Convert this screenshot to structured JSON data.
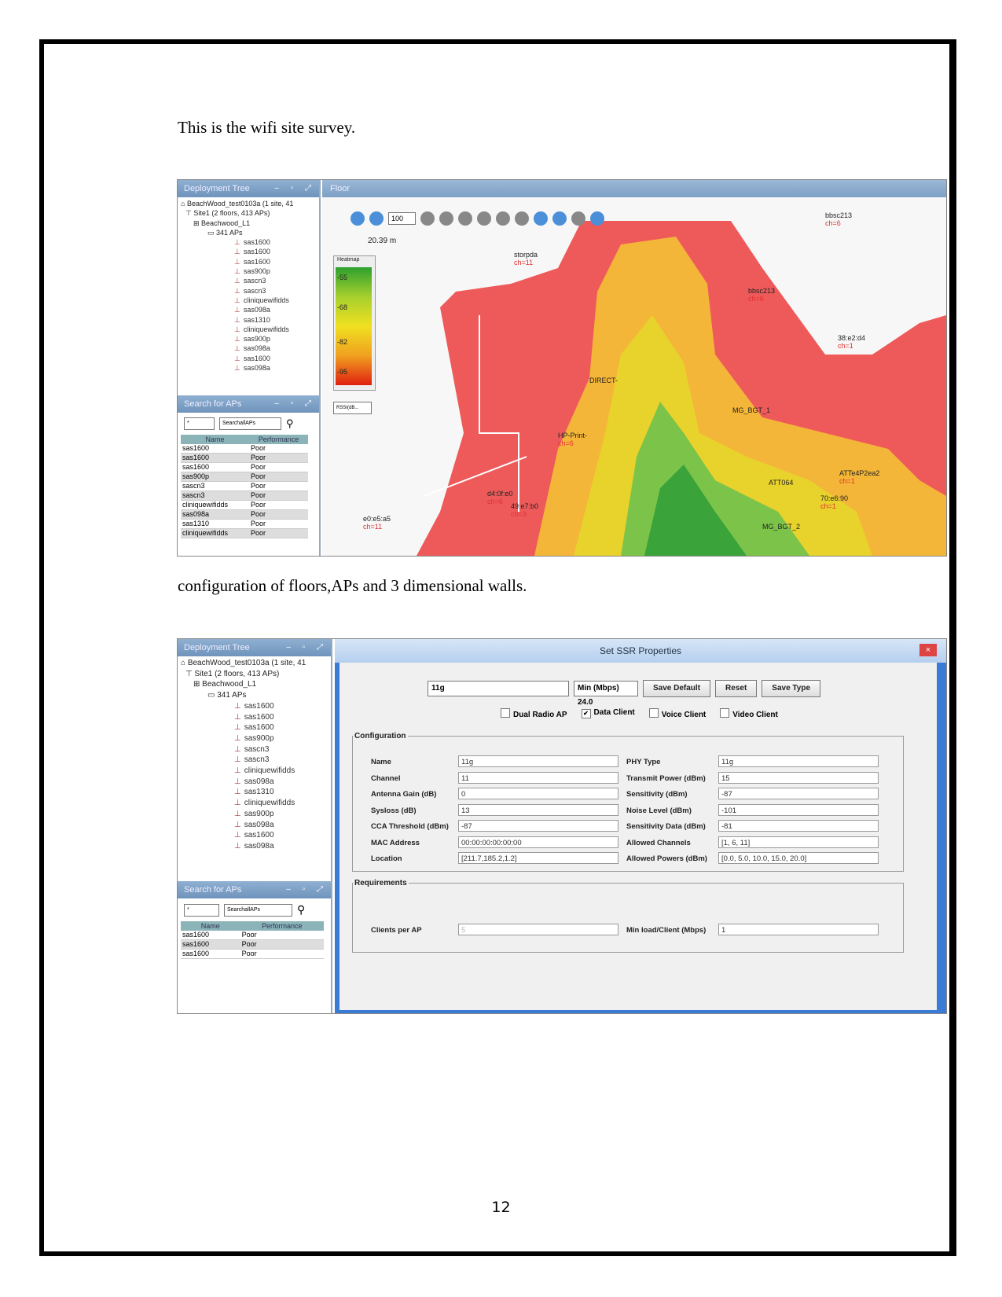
{
  "text": {
    "intro": "This is the wifi site survey.",
    "caption": "configuration of floors,APs and 3 dimensional walls.",
    "page_number": "12"
  },
  "shot1": {
    "deployment_title": "Deployment Tree",
    "tree": {
      "root": "BeachWood_test0103a (1 site, 41",
      "site": "Site1 (2 floors, 413 APs)",
      "floor": "Beachwood_L1",
      "group": "341 APs",
      "aps": [
        "sas1600",
        "sas1600",
        "sas1600",
        "sas900p",
        "sascn3",
        "sascn3",
        "cliniquewifidds",
        "sas098a",
        "sas1310",
        "cliniquewifidds",
        "sas900p",
        "sas098a",
        "sas1600",
        "sas098a"
      ]
    },
    "search_title": "Search for APs",
    "search_value": "*",
    "search_scope": "SearchallAPs",
    "table_headers": [
      "Name",
      "Performance"
    ],
    "table_rows": [
      [
        "sas1600",
        "Poor"
      ],
      [
        "sas1600",
        "Poor"
      ],
      [
        "sas1600",
        "Poor"
      ],
      [
        "sas900p",
        "Poor"
      ],
      [
        "sascn3",
        "Poor"
      ],
      [
        "sascn3",
        "Poor"
      ],
      [
        "cliniquewifidds",
        "Poor"
      ],
      [
        "sas098a",
        "Poor"
      ],
      [
        "sas1310",
        "Poor"
      ],
      [
        "cliniquewifidds",
        "Poor"
      ]
    ],
    "floor_title": "Floor",
    "zoom": "100",
    "scale_value": "20.39",
    "scale_unit": "m",
    "heatmap_title": "Heatmap",
    "heatmap_ticks": [
      "-55",
      "-68",
      "-82",
      "-95"
    ],
    "rssi_select": "RSSI(dB...",
    "map_labels": [
      {
        "name": "storpda",
        "ch": "ch=11"
      },
      {
        "name": "bbsc213",
        "ch": "ch=6"
      },
      {
        "name": "bbsc213",
        "ch": "ch=6"
      },
      {
        "name": "38:e2:d4",
        "ch": "ch=1"
      },
      {
        "name": "MG_BGT_1",
        "ch": ""
      },
      {
        "name": "ATTe4P2ea2",
        "ch": "ch=1"
      },
      {
        "name": "70:e6:90",
        "ch": "ch=1"
      },
      {
        "name": "MG_BGT_2",
        "ch": ""
      },
      {
        "name": "d4:0f:e0",
        "ch": "ch=6"
      },
      {
        "name": "49:e7:b0",
        "ch": "ch=3"
      },
      {
        "name": "e0:e5:a5",
        "ch": "ch=11"
      },
      {
        "name": "ATT064",
        "ch": ""
      },
      {
        "name": "DIRECT-",
        "ch": ""
      },
      {
        "name": "HP-Print-",
        "ch": "ch=6"
      }
    ]
  },
  "shot2": {
    "deployment_title": "Deployment Tree",
    "tree": {
      "root": "BeachWood_test0103a (1 site, 41",
      "site": "Site1 (2 floors, 413 APs)",
      "floor": "Beachwood_L1",
      "group": "341 APs",
      "aps": [
        "sas1600",
        "sas1600",
        "sas1600",
        "sas900p",
        "sascn3",
        "sascn3",
        "cliniquewifidds",
        "sas098a",
        "sas1310",
        "cliniquewifidds",
        "sas900p",
        "sas098a",
        "sas1600",
        "sas098a"
      ]
    },
    "search_title": "Search for APs",
    "search_value": "*",
    "search_scope": "SearchallAPs",
    "table_headers": [
      "Name",
      "Performance"
    ],
    "table_rows": [
      [
        "sas1600",
        "Poor"
      ],
      [
        "sas1600",
        "Poor"
      ],
      [
        "sas1600",
        "Poor"
      ]
    ],
    "dialog": {
      "title": "Set SSR Properties",
      "close": "×",
      "type_select": "11g",
      "min_select": "Min (Mbps) 24.0",
      "buttons": {
        "save_default": "Save Default",
        "reset": "Reset",
        "save_type": "Save Type"
      },
      "checkboxes": [
        {
          "label": "Dual Radio AP",
          "checked": false
        },
        {
          "label": "Data Client",
          "checked": true
        },
        {
          "label": "Voice Client",
          "checked": false
        },
        {
          "label": "Video Client",
          "checked": false
        }
      ],
      "configuration_legend": "Configuration",
      "left_fields": [
        {
          "label": "Name",
          "value": "11g"
        },
        {
          "label": "Channel",
          "value": "11"
        },
        {
          "label": "Antenna Gain (dB)",
          "value": "0"
        },
        {
          "label": "Sysloss (dB)",
          "value": "13"
        },
        {
          "label": "CCA Threshold (dBm)",
          "value": "-87"
        },
        {
          "label": "MAC Address",
          "value": "00:00:00:00:00:00"
        },
        {
          "label": "Location",
          "value": "[211.7,185.2,1.2]"
        }
      ],
      "right_fields": [
        {
          "label": "PHY Type",
          "value": "11g"
        },
        {
          "label": "Transmit Power (dBm)",
          "value": "15"
        },
        {
          "label": "Sensitivity (dBm)",
          "value": "-87"
        },
        {
          "label": "Noise Level (dBm)",
          "value": "-101"
        },
        {
          "label": "Sensitivity Data (dBm)",
          "value": "-81"
        },
        {
          "label": "Allowed Channels",
          "value": "[1, 6, 11]"
        },
        {
          "label": "Allowed Powers (dBm)",
          "value": "[0.0, 5.0, 10.0, 15.0, 20.0]"
        }
      ],
      "requirements_legend": "Requirements",
      "clients_label": "Clients per AP",
      "clients_value": "5",
      "minload_label": "Min load/Client (Mbps)",
      "minload_value": "1"
    }
  }
}
